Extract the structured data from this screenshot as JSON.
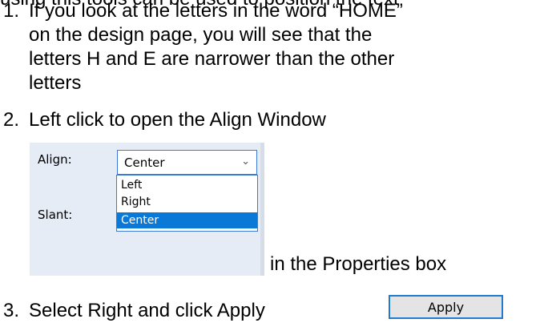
{
  "top_partial_text": "using this tools can be used to position the text",
  "steps": [
    {
      "number": "1.",
      "lines": [
        "If you look at the letters in the word “HOME”",
        "on the design page, you will see that the",
        "letters H and E are narrower than the other",
        "letters"
      ]
    },
    {
      "number": "2.",
      "text": "Left click to open the Align Window"
    },
    {
      "number": "3.",
      "text": "Select Right and click Apply"
    }
  ],
  "after_panel_text": "in the Properties box",
  "properties_panel": {
    "align_label": "Align:",
    "slant_label": "Slant:",
    "selected_value": "Center",
    "chevron_icon": "chevron-down-icon",
    "options": [
      "Left",
      "Right",
      "Center"
    ],
    "highlighted_option": "Center"
  },
  "apply_button": {
    "label": "Apply"
  }
}
